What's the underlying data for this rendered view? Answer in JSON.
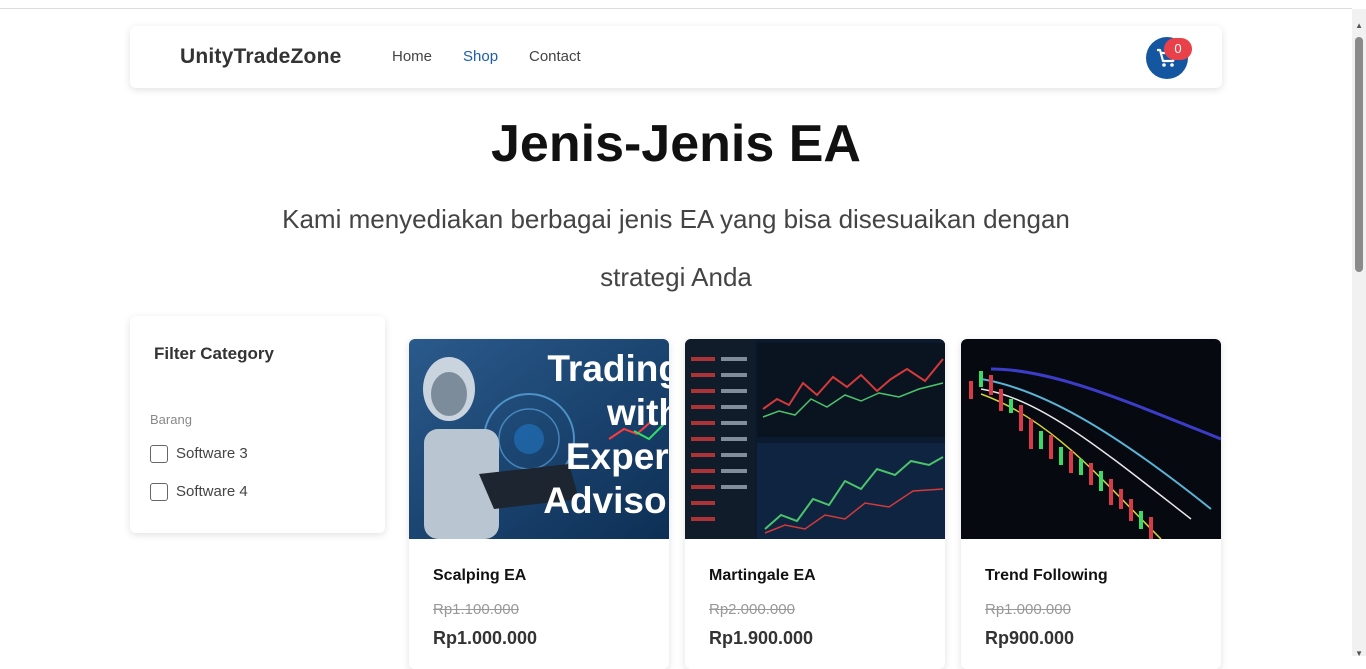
{
  "header": {
    "brand": "UnityTradeZone",
    "nav": [
      {
        "label": "Home"
      },
      {
        "label": "Shop"
      },
      {
        "label": "Contact"
      }
    ],
    "cart_count": "0"
  },
  "hero": {
    "title": "Jenis-Jenis EA",
    "subtitle": "Kami menyediakan berbagai jenis EA yang bisa disesuaikan dengan strategi Anda"
  },
  "filter": {
    "title": "Filter Category",
    "group_label": "Barang",
    "options": [
      {
        "label": "Software 3"
      },
      {
        "label": "Software 4"
      }
    ]
  },
  "products": [
    {
      "name": "Scalping EA",
      "old_price": "Rp1.100.000",
      "price": "Rp1.000.000",
      "image_text": "Trading with Expert Advisor"
    },
    {
      "name": "Martingale EA",
      "old_price": "Rp2.000.000",
      "price": "Rp1.900.000"
    },
    {
      "name": "Trend Following",
      "old_price": "Rp1.000.000",
      "price": "Rp900.000"
    }
  ],
  "colors": {
    "accent": "#1a5fa8",
    "cart_bg": "#1456a0",
    "badge": "#e8414a"
  }
}
